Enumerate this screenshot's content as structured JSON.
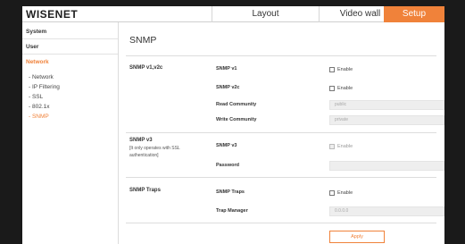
{
  "header": {
    "logo": "WISENET",
    "tabs": [
      {
        "label": "Layout"
      },
      {
        "label": "Video wall"
      },
      {
        "label": "Setup"
      }
    ]
  },
  "sidebar": {
    "sections": [
      {
        "label": "System"
      },
      {
        "label": "User"
      },
      {
        "label": "Network"
      }
    ],
    "network_items": [
      {
        "label": "- Network"
      },
      {
        "label": "- IP Filtering"
      },
      {
        "label": "- SSL"
      },
      {
        "label": "- 802.1x"
      },
      {
        "label": "- SNMP"
      }
    ]
  },
  "main": {
    "title": "SNMP",
    "snmp_v12": {
      "section_label": "SNMP v1,v2c",
      "v1_label": "SNMP v1",
      "v1_enable": "Enable",
      "v2c_label": "SNMP v2c",
      "v2c_enable": "Enable",
      "read_label": "Read Community",
      "read_value": "public",
      "write_label": "Write Community",
      "write_value": "private"
    },
    "snmp_v3": {
      "section_label": "SNMP v3",
      "note": "[It only operates with SSL authentication]",
      "v3_label": "SNMP v3",
      "v3_enable": "Enable",
      "password_label": "Password",
      "password_value": ""
    },
    "traps": {
      "section_label": "SNMP Traps",
      "traps_label": "SNMP Traps",
      "traps_enable": "Enable",
      "manager_label": "Trap Manager",
      "manager_value": "0.0.0.0"
    },
    "apply_label": "Apply"
  },
  "colors": {
    "accent": "#f0823a",
    "frame_background": "#1a1a1a",
    "input_background": "#eeeeee"
  }
}
